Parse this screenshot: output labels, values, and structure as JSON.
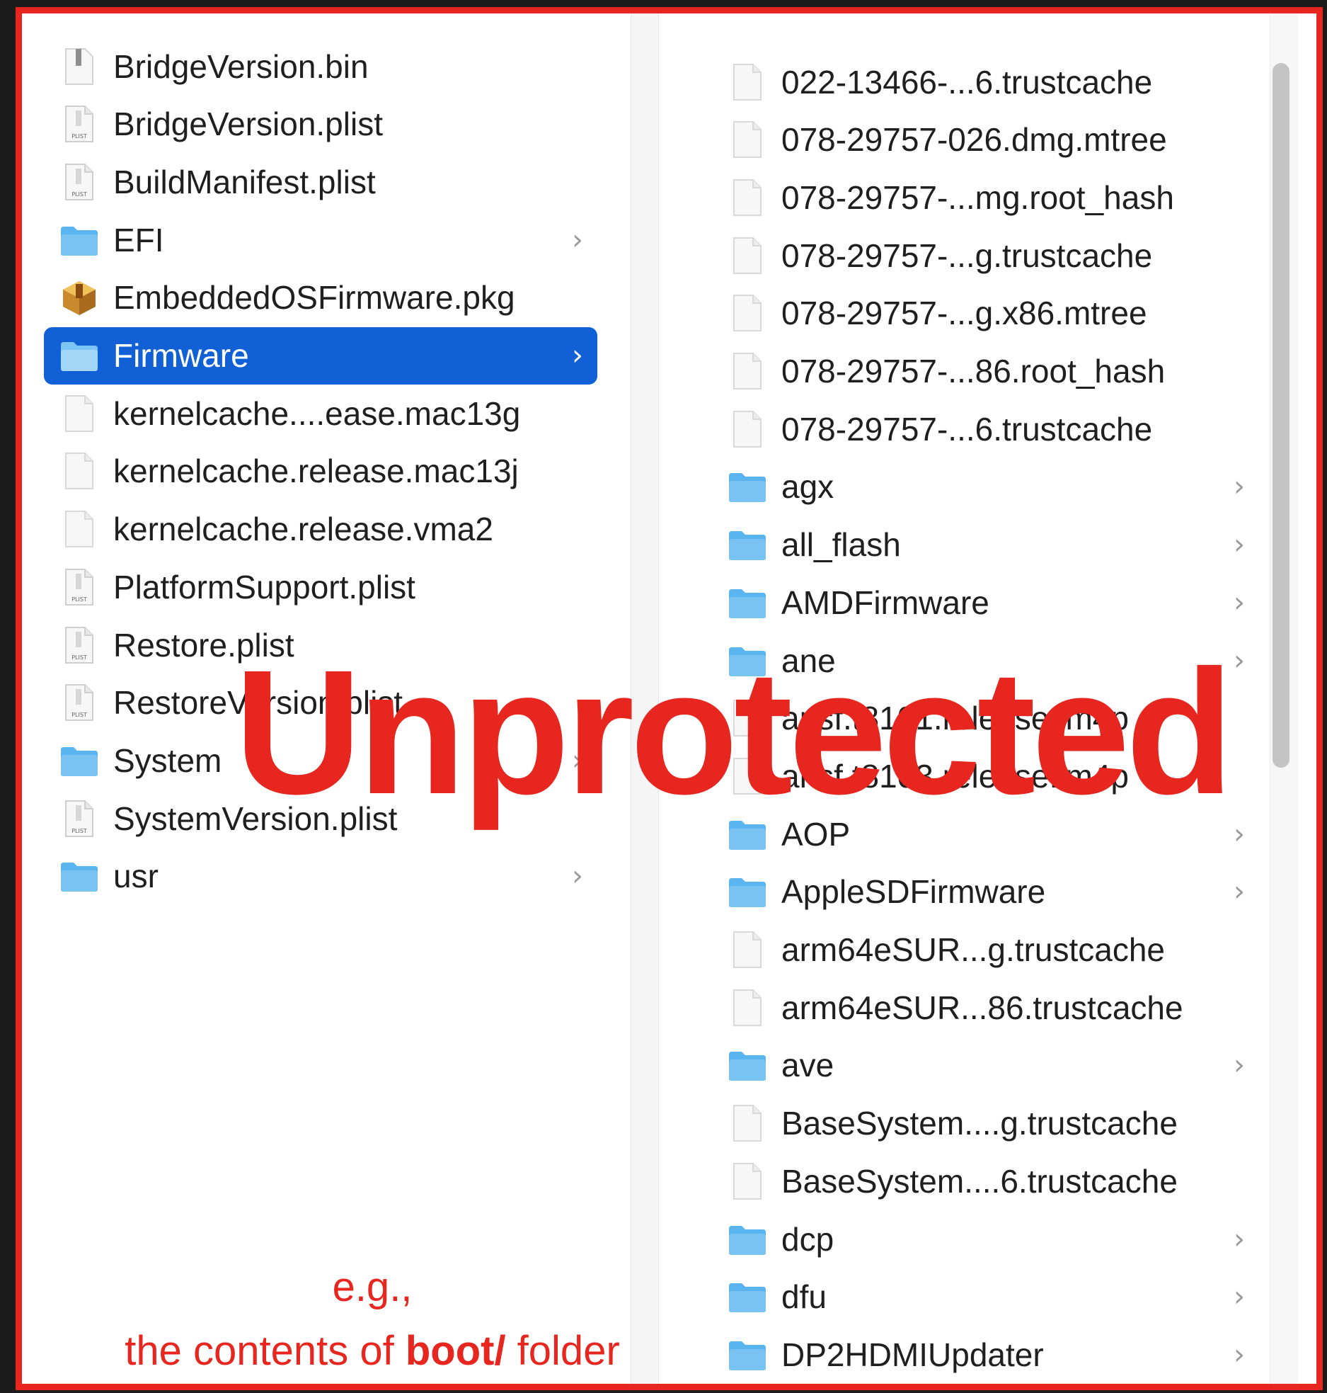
{
  "left_column": {
    "items": [
      {
        "label": "BridgeVersion.bin",
        "icon": "binary-file-icon",
        "folder": false
      },
      {
        "label": "BridgeVersion.plist",
        "icon": "plist-file-icon",
        "folder": false
      },
      {
        "label": "BuildManifest.plist",
        "icon": "plist-file-icon",
        "folder": false
      },
      {
        "label": "EFI",
        "icon": "folder-icon",
        "folder": true
      },
      {
        "label": "EmbeddedOSFirmware.pkg",
        "icon": "package-icon",
        "folder": false
      },
      {
        "label": "Firmware",
        "icon": "folder-icon",
        "folder": true,
        "selected": true
      },
      {
        "label": "kernelcache....ease.mac13g",
        "icon": "document-icon",
        "folder": false
      },
      {
        "label": "kernelcache.release.mac13j",
        "icon": "document-icon",
        "folder": false
      },
      {
        "label": "kernelcache.release.vma2",
        "icon": "document-icon",
        "folder": false
      },
      {
        "label": "PlatformSupport.plist",
        "icon": "plist-file-icon",
        "folder": false
      },
      {
        "label": "Restore.plist",
        "icon": "plist-file-icon",
        "folder": false
      },
      {
        "label": "RestoreVersion.plist",
        "icon": "plist-file-icon",
        "folder": false
      },
      {
        "label": "System",
        "icon": "folder-icon",
        "folder": true
      },
      {
        "label": "SystemVersion.plist",
        "icon": "plist-file-icon",
        "folder": false
      },
      {
        "label": "usr",
        "icon": "folder-icon",
        "folder": true
      }
    ]
  },
  "right_column": {
    "items": [
      {
        "label": "022-13466-...6.trustcache",
        "icon": "document-icon",
        "folder": false
      },
      {
        "label": "078-29757-026.dmg.mtree",
        "icon": "document-icon",
        "folder": false
      },
      {
        "label": "078-29757-...mg.root_hash",
        "icon": "document-icon",
        "folder": false
      },
      {
        "label": "078-29757-...g.trustcache",
        "icon": "document-icon",
        "folder": false
      },
      {
        "label": "078-29757-...g.x86.mtree",
        "icon": "document-icon",
        "folder": false
      },
      {
        "label": "078-29757-...86.root_hash",
        "icon": "document-icon",
        "folder": false
      },
      {
        "label": "078-29757-...6.trustcache",
        "icon": "document-icon",
        "folder": false
      },
      {
        "label": "agx",
        "icon": "folder-icon",
        "folder": true
      },
      {
        "label": "all_flash",
        "icon": "folder-icon",
        "folder": true
      },
      {
        "label": "AMDFirmware",
        "icon": "folder-icon",
        "folder": true
      },
      {
        "label": "ane",
        "icon": "folder-icon",
        "folder": true
      },
      {
        "label": "ansf.t8101.release.im4p",
        "icon": "document-icon",
        "folder": false
      },
      {
        "label": "ansf.t8103.release.im4p",
        "icon": "document-icon",
        "folder": false
      },
      {
        "label": "AOP",
        "icon": "folder-icon",
        "folder": true
      },
      {
        "label": "AppleSDFirmware",
        "icon": "folder-icon",
        "folder": true
      },
      {
        "label": "arm64eSUR...g.trustcache",
        "icon": "document-icon",
        "folder": false
      },
      {
        "label": "arm64eSUR...86.trustcache",
        "icon": "document-icon",
        "folder": false
      },
      {
        "label": "ave",
        "icon": "folder-icon",
        "folder": true
      },
      {
        "label": "BaseSystem....g.trustcache",
        "icon": "document-icon",
        "folder": false
      },
      {
        "label": "BaseSystem....6.trustcache",
        "icon": "document-icon",
        "folder": false
      },
      {
        "label": "dcp",
        "icon": "folder-icon",
        "folder": true
      },
      {
        "label": "dfu",
        "icon": "folder-icon",
        "folder": true
      },
      {
        "label": "DP2HDMIUpdater",
        "icon": "folder-icon",
        "folder": true
      }
    ]
  },
  "overlay": {
    "watermark": "Unprotected",
    "caption_line1": "e.g.,",
    "caption_pre": "the contents of ",
    "caption_bold": "boot/",
    "caption_post": " folder"
  },
  "colors": {
    "accent_red": "#e6261f",
    "selection_blue": "#1260d6",
    "folder_blue": "#5ab4ef"
  }
}
